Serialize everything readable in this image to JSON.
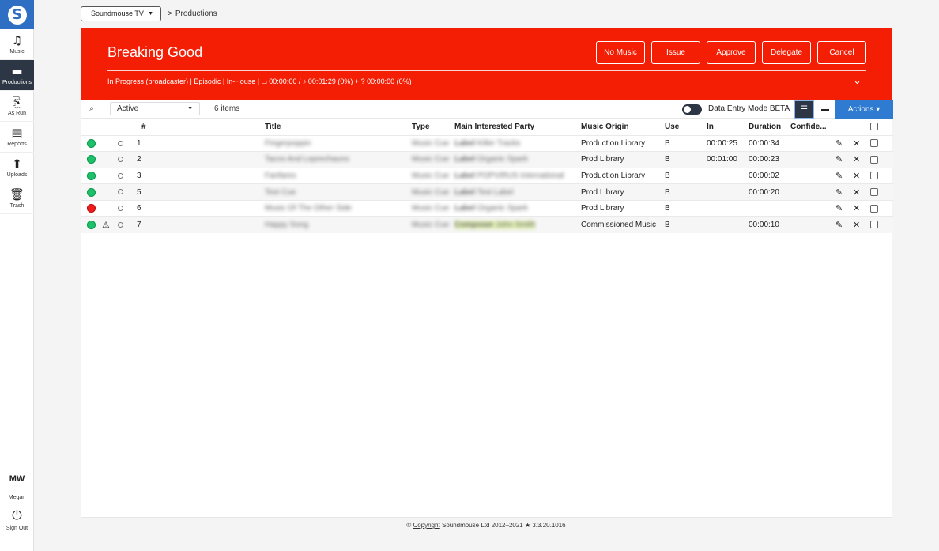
{
  "sidebar": {
    "logo_icon": "soundmouse-logo-icon",
    "items": [
      {
        "label": "Music",
        "icon": "music-note-icon"
      },
      {
        "label": "Productions",
        "icon": "clapperboard-icon"
      },
      {
        "label": "As Run",
        "icon": "broadcast-document-icon"
      },
      {
        "label": "Reports",
        "icon": "report-icon"
      },
      {
        "label": "Uploads",
        "icon": "upload-icon"
      },
      {
        "label": "Trash",
        "icon": "trash-icon"
      }
    ],
    "user_initials": "MW",
    "user_name": "Megan",
    "signout_label": "Sign Out"
  },
  "breadcrumb": {
    "account": "Soundmouse TV",
    "separator": ">",
    "page": "Productions"
  },
  "production": {
    "title": "Breaking Good",
    "status_line": "In Progress (broadcaster) | Episodic | In-House | ⌴ 00:00:00 / ♪ 00:01:29 (0%) + ? 00:00:00 (0%)",
    "buttons": [
      "No Music",
      "Issue",
      "Approve",
      "Delegate",
      "Cancel"
    ]
  },
  "toolbar": {
    "filter_value": "Active",
    "items_count": "6 items",
    "data_entry_label": "Data Entry Mode BETA",
    "actions_label": "Actions ▾"
  },
  "table": {
    "headers": [
      "#",
      "Title",
      "Type",
      "Main Interested Party",
      "Music Origin",
      "Use",
      "In",
      "Duration",
      "Confide..."
    ],
    "rows": [
      {
        "status": "green",
        "warning": false,
        "num": "1",
        "title": "Fingerpoppin",
        "type": "Music Cue",
        "party_role": "Label",
        "party_name": "Killer Tracks",
        "origin": "Production Library",
        "use": "B",
        "in": "00:00:25",
        "duration": "00:00:34"
      },
      {
        "status": "green",
        "warning": false,
        "num": "2",
        "title": "Tacos And Leprechauns",
        "type": "Music Cue",
        "party_role": "Label",
        "party_name": "Organic Spark",
        "origin": "Prod Library",
        "use": "B",
        "in": "00:01:00",
        "duration": "00:00:23"
      },
      {
        "status": "green",
        "warning": false,
        "num": "3",
        "title": "Fanfares",
        "type": "Music Cue",
        "party_role": "Label",
        "party_name": "POPVIRUS International",
        "origin": "Production Library",
        "use": "B",
        "in": "",
        "duration": "00:00:02"
      },
      {
        "status": "green",
        "warning": false,
        "num": "5",
        "title": "Test Cue",
        "type": "Music Cue",
        "party_role": "Label",
        "party_name": "Test Label",
        "origin": "Prod Library",
        "use": "B",
        "in": "",
        "duration": "00:00:20"
      },
      {
        "status": "red",
        "warning": false,
        "num": "6",
        "title": "Music Of The Other Side",
        "type": "Music Cue",
        "party_role": "Label",
        "party_name": "Organic Spark",
        "origin": "Prod Library",
        "use": "B",
        "in": "",
        "duration": ""
      },
      {
        "status": "green",
        "warning": true,
        "num": "7",
        "title": "Happy Song",
        "type": "Music Cue",
        "party_role": "Composer",
        "party_name": "John Smith",
        "origin": "Commissioned Music",
        "use": "B",
        "in": "",
        "duration": "00:00:10"
      }
    ]
  },
  "footer": {
    "copyright_symbol": "©",
    "copyright_link": "Copyright",
    "text": "Soundmouse Ltd 2012–2021 ★ 3.3.20.1016"
  },
  "colors": {
    "header_red": "#f41e04",
    "brand_blue": "#2f6fc3",
    "actions_blue": "#2f7bd1",
    "nav_active": "#2d3644",
    "status_green": "#1fbf6b",
    "status_red": "#ef1d1d"
  }
}
